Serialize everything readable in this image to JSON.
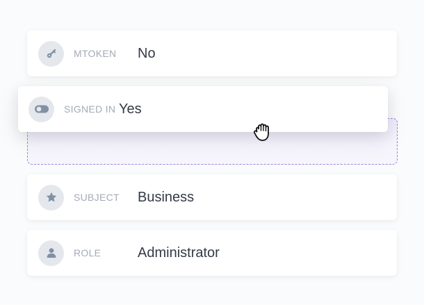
{
  "fields": [
    {
      "key": "mtoken",
      "label": "MTOKEN",
      "value": "No",
      "icon": "key-icon"
    },
    {
      "key": "signed_in",
      "label": "SIGNED IN",
      "value": "Yes",
      "icon": "toggle-icon",
      "state": "dragging"
    },
    {
      "key": "subject",
      "label": "SUBJECT",
      "value": "Business",
      "icon": "star-icon"
    },
    {
      "key": "role",
      "label": "ROLE",
      "value": "Administrator",
      "icon": "user-icon"
    }
  ],
  "drop_zone": {
    "state": "empty-placeholder"
  },
  "cursor": {
    "icon": "grab-hand-cursor-icon"
  },
  "colors": {
    "background": "#fafbfc",
    "card": "#ffffff",
    "icon_circle": "#e4e8ed",
    "icon_glyph": "#8190a3",
    "label": "#a3abb5",
    "value": "#333a45",
    "drop_border": "#9b86dc",
    "drop_fill": "#f3f0fb"
  }
}
